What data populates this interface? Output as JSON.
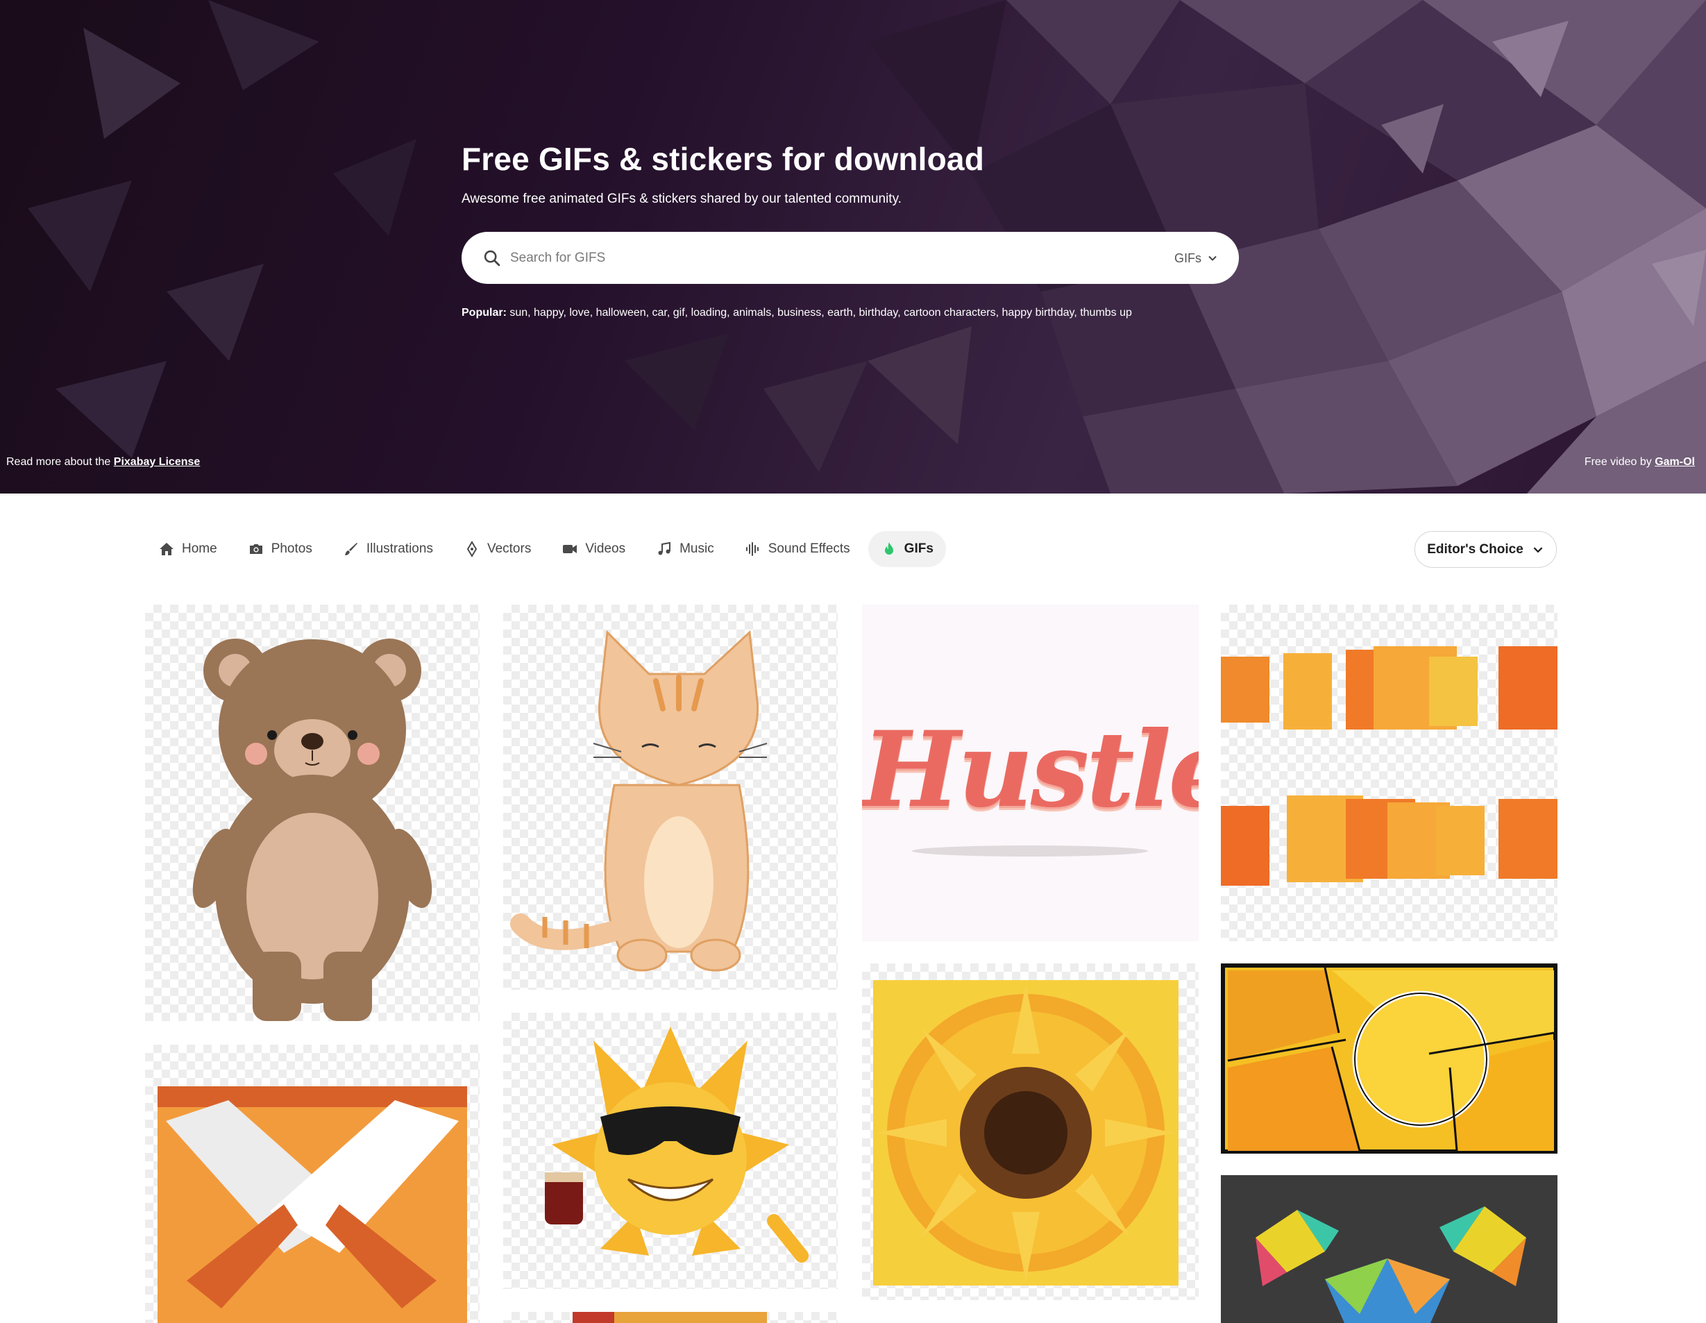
{
  "hero": {
    "title": "Free GIFs & stickers for download",
    "subtitle": "Awesome free animated GIFs & stickers shared by our talented community.",
    "search_placeholder": "Search for GIFS",
    "media_type": "GIFs",
    "popular_label": "Popular:",
    "popular_tags": [
      "sun",
      "happy",
      "love",
      "halloween",
      "car",
      "gif",
      "loading",
      "animals",
      "business",
      "earth",
      "birthday",
      "cartoon characters",
      "happy birthday",
      "thumbs up"
    ],
    "license_prefix": "Read more about the",
    "license_link": "Pixabay License",
    "credit_prefix": "Free video by",
    "credit_author": "Gam-Ol"
  },
  "nav": {
    "items": [
      {
        "label": "Home",
        "icon": "home-icon"
      },
      {
        "label": "Photos",
        "icon": "camera-icon"
      },
      {
        "label": "Illustrations",
        "icon": "brush-icon"
      },
      {
        "label": "Vectors",
        "icon": "pen-nib-icon"
      },
      {
        "label": "Videos",
        "icon": "video-camera-icon"
      },
      {
        "label": "Music",
        "icon": "music-note-icon"
      },
      {
        "label": "Sound Effects",
        "icon": "waveform-icon"
      },
      {
        "label": "GIFs",
        "icon": "gif-flame-icon",
        "active": true
      }
    ],
    "sort_label": "Editor's Choice"
  },
  "gallery": {
    "hustle_text": "Hustle",
    "tiles": [
      "teddy bear",
      "tabby cat",
      "hustle lettering",
      "orange stripes",
      "envelope",
      "sun with sunglasses",
      "sunflower",
      "comic halftone panels",
      "low poly figure"
    ]
  },
  "colors": {
    "accent": "#2ec66d",
    "hero_dark": "#1a0c1a",
    "hero_violet": "#3a2444"
  }
}
